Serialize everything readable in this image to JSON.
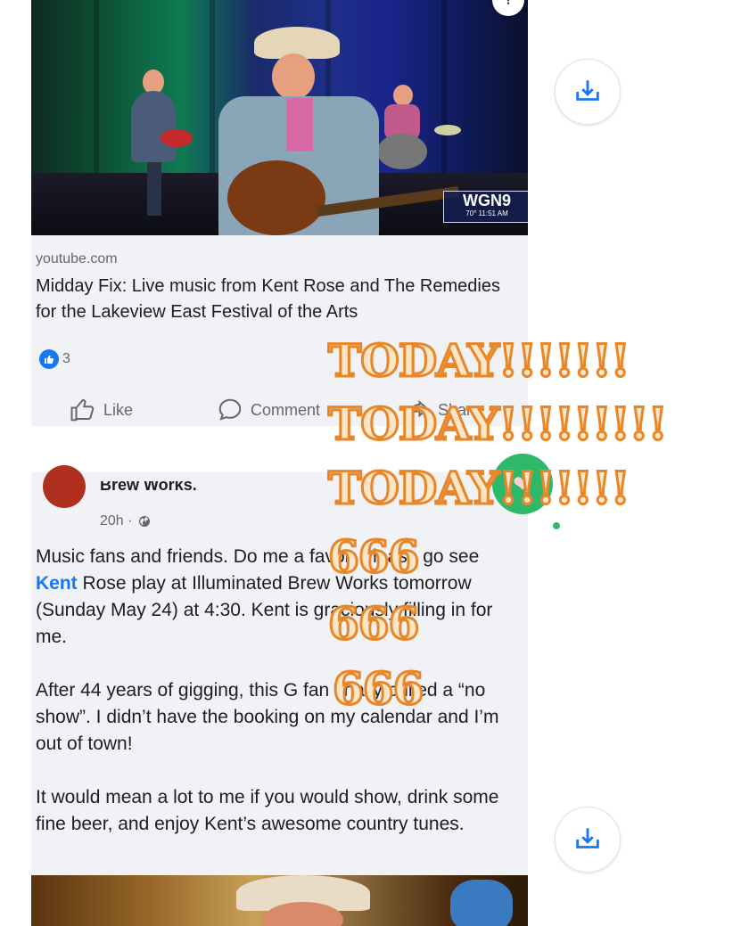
{
  "video_post": {
    "source": "youtube.com",
    "title": "Midday Fix: Live music from Kent Rose and The Remedies for the Lakeview East Festival of the Arts",
    "broadcaster_logo": "WGN9",
    "broadcaster_ticker": "70° 11:51 AM",
    "reaction_icon": "like-icon",
    "reaction_count": "3",
    "actions": {
      "like": "Like",
      "comment": "Comment",
      "share": "Share"
    }
  },
  "text_post": {
    "page_name": "Brew Works.",
    "time": "20h ·",
    "privacy_icon": "globe-icon",
    "paragraph1_before": "Music fans and friends. Do me a favor. Please go see ",
    "paragraph1_link": "Kent",
    "paragraph1_after": " Rose play at Illuminated Brew Works tomorrow (Sunday May 24) at 4:30. Kent is graciously filling in for me.",
    "paragraph2": "After 44 years of gigging, this G fan finally pulled a “no show”. I didn’t have the booking on my calendar and I’m out of town!",
    "paragraph3": "It would mean a lot to me if you would show, drink some fine beer, and enjoy Kent’s awesome country tunes."
  },
  "overlay": {
    "line1": "TODAY!!!!!!!",
    "line2": "TODAY!!!!!!!!!",
    "line3": "TODAY!!!!!!!",
    "num1": "666",
    "num2": "666",
    "num3": "666",
    "sticker_icon": "heart-eyes-sticker"
  },
  "side_buttons": {
    "icon": "download-icon"
  },
  "colors": {
    "accent": "#1877f2",
    "overlay_stroke": "#e8862a",
    "overlay_fill": "#fbe7c8",
    "sticker": "#2eb86a"
  }
}
